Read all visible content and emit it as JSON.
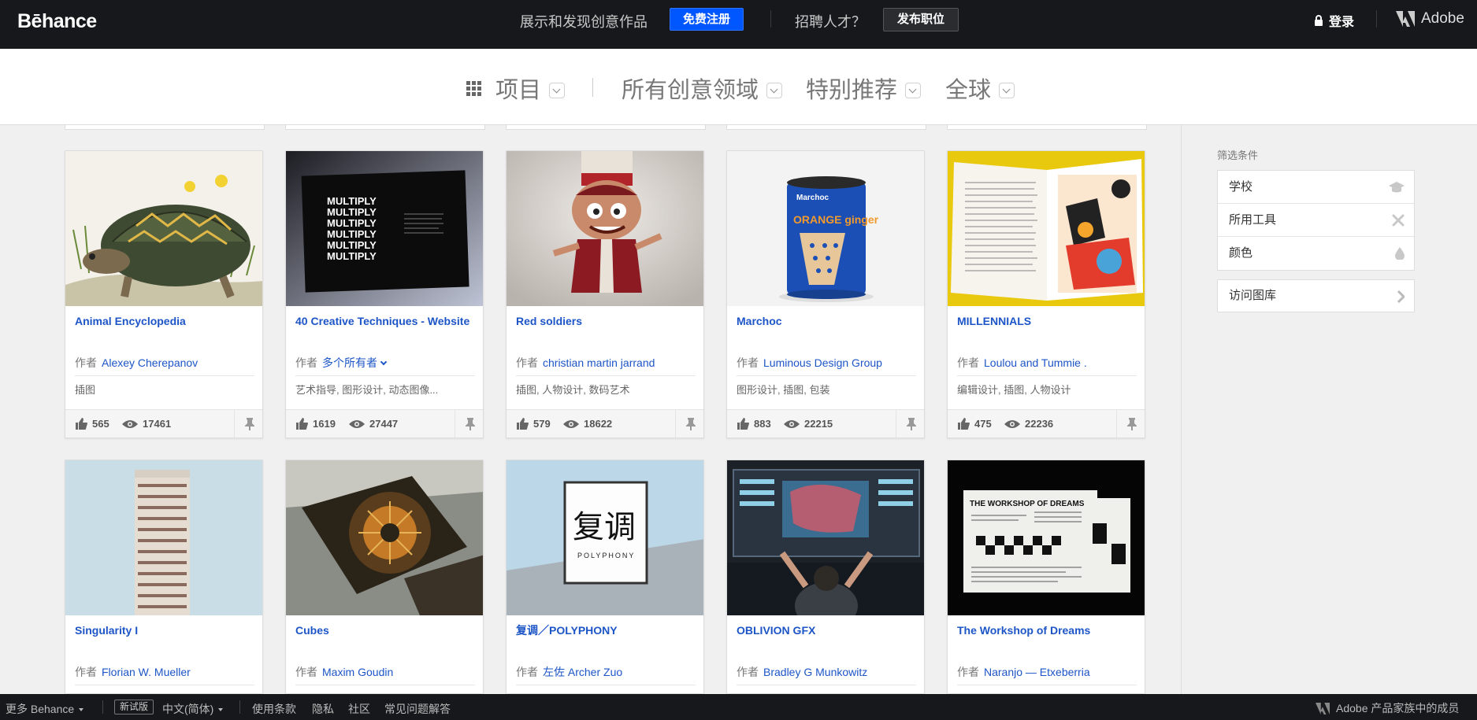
{
  "topbar": {
    "logo": "Bēhance",
    "tagline": "展示和发现创意作品",
    "signup_label": "免费注册",
    "hire_text": "招聘人才？",
    "post_job_label": "发布职位",
    "login_label": "登录",
    "adobe_label": "Adobe"
  },
  "filters": {
    "projects": "项目",
    "fields": "所有创意领域",
    "featured": "特别推荐",
    "location": "全球"
  },
  "owner_prefix": "作者",
  "projects": [
    {
      "title": "Animal Encyclopedia",
      "owner": "Alexey Cherepanov",
      "fields": "插图",
      "likes": "565",
      "views": "17461"
    },
    {
      "title": "40 Creative Techniques - Website",
      "owner": "多个所有者",
      "fields": "艺术指导, 图形设计, 动态图像...",
      "likes": "1619",
      "views": "27447"
    },
    {
      "title": "Red soldiers",
      "owner": "christian martin jarrand",
      "fields": "插图, 人物设计, 数码艺术",
      "likes": "579",
      "views": "18622"
    },
    {
      "title": "Marchoc",
      "owner": "Luminous Design Group",
      "fields": "图形设计, 插图, 包装",
      "likes": "883",
      "views": "22215"
    },
    {
      "title": "MILLENNIALS",
      "owner": "Loulou and Tummie .",
      "fields": "编辑设计, 插图, 人物设计",
      "likes": "475",
      "views": "22236"
    },
    {
      "title": "Singularity I",
      "owner": "Florian W. Mueller"
    },
    {
      "title": "Cubes",
      "owner": "Maxim Goudin"
    },
    {
      "title": "复调／POLYPHONY",
      "owner": "左佐 Archer Zuo"
    },
    {
      "title": "OBLIVION GFX",
      "owner": "Bradley G Munkowitz"
    },
    {
      "title": "The Workshop of Dreams",
      "owner": "Naranjo — Etxeberria"
    }
  ],
  "thumb_text": {
    "multiply": "MULTIPLY",
    "marchoc_brand": "Marchoc",
    "marchoc_flavor": "ORANGE ginger",
    "fudiao": "复调",
    "polyphony": "POLYPHONY",
    "workshop": "THE WORKSHOP OF DREAMS"
  },
  "sidebar": {
    "title": "筛选条件",
    "items": [
      "学校",
      "所用工具",
      "颜色"
    ],
    "gallery": "访问图库"
  },
  "footer": {
    "more": "更多 Behance",
    "beta": "新试版",
    "language": "中文(简体)",
    "terms": "使用条款",
    "privacy": "隐私",
    "community": "社区",
    "faq": "常见问题解答",
    "adobe_family": "Adobe 产品家族中的成员"
  },
  "colors": {
    "topbar": "#17181b",
    "accent_blue": "#0057ff",
    "link_blue": "#1d55c7"
  }
}
